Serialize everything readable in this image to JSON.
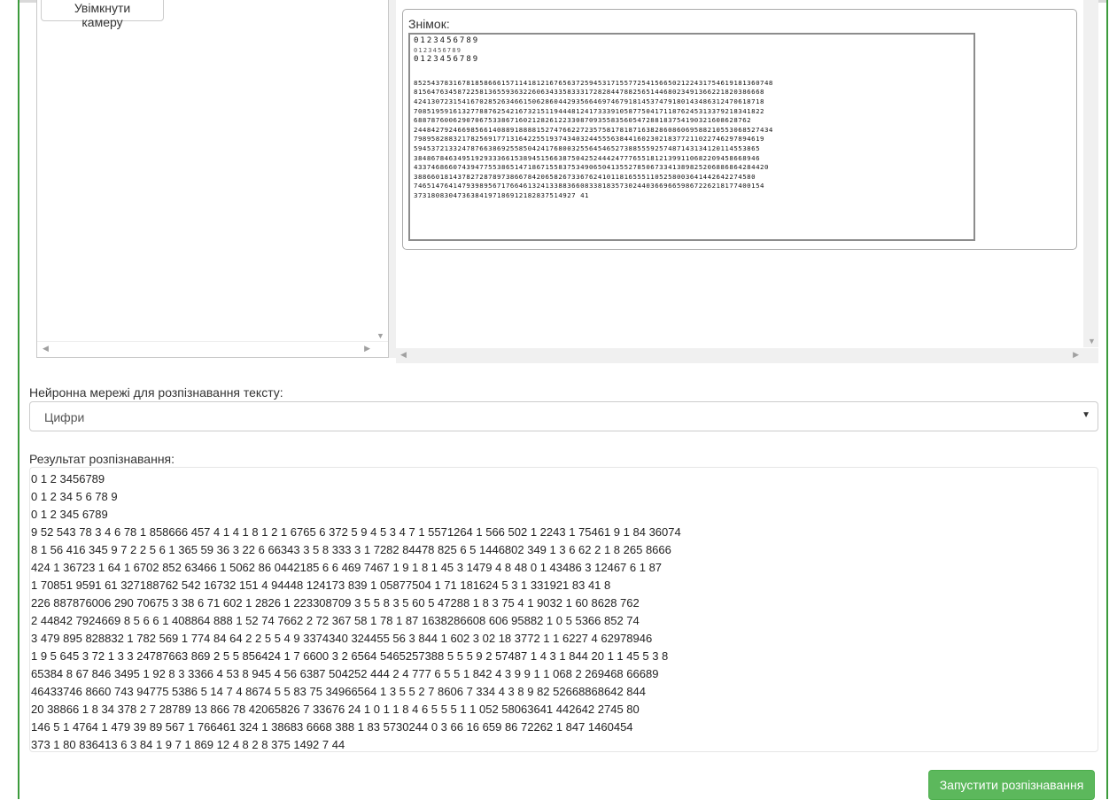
{
  "camera": {
    "enable_button": "Увімкнути камеру"
  },
  "snapshot": {
    "legend": "Знімок:",
    "header_lines": [
      "0123456789",
      "0123456789",
      "0123456789"
    ],
    "digit_lines": [
      "8525437831678185866615711418121676563725945317155772541566502122431754619181360748",
      "81564763458722581365593632260634335833317282844788256514468023491366221820386668",
      "42413072315416702852634661506286044293566469746791814537479180143486312470618718",
      "70851959161327788762542167321511944481241733391058775041711876245313379218341822",
      "68878760062907067533867160212826122330870935583560547288183754190321608628762",
      "2448427924669856614088918888152747662272357581781871638286086069588210553068527434",
      "79895828832178256917713164225519374340324455563844160230218377211022746297894619",
      "5945372133247876638692558504241768003255645465273885559257487143134120114553865",
      "3848678463495192933366153894515663875042524442477765518121399110682209458668946",
      "433746866074394775538651471867155837534906504135527850673341389825206886864284420",
      "388660181437827287897386678420658267336762410118165551105258003641442642274580",
      "74651476414793989567176646132413388366083381835730244036696659867226218177400154",
      "3731808304736384197186912182837514927 41"
    ]
  },
  "network": {
    "label": "Нейронна мережі для розпізнавання тексту:",
    "selected": "Цифри"
  },
  "result": {
    "label": "Результат розпізнавання:",
    "lines": [
      "0 1 2 3456789",
      "0 1 2 34 5 6 78 9",
      "0 1 2 345 6789",
      "9 52 543 78 3 4 6 78 1 858666 457 4 1 4 1 8 1 2 1 6765 6 372 5 9 4 5 3 4 7 1 5571264 1 566 502 1 2243 1 75461 9 1 84 36074",
      "8 1 56 416 345 9 7 2 2 5 6 1 365 59 36 3 22 6 66343 3 5 8 333 3 1 7282 84478 825 6 5 1446802 349 1 3 6 62 2 1 8 265 8666",
      "424 1 36723 1 64 1 6702 852 63466 1 5062 86 0442185 6 6 469 7467 1 9 1 8 1 45 3 1479 4 8 48 0 1 43486 3 12467 6 1 87",
      "1 70851 9591 61 327188762 542 16732 151 4 94448 124173 839 1 05877504 1 71 181624 5 3 1 331921 83 41 8",
      "226 887876006 290 70675 3 38 6 71 602 1 2826 1 223308709 3 5 5 8 3 5 60 5 47288 1 8 3 75 4 1 9032 1 60 8628 762",
      "2 44842 7924669 8 5 6 6 1 408864 888 1 52 74 7662 2 72 367 58 1 78 1 87 1638286608 606 95882 1 0 5 5366 852 74",
      "3 479 895 828832 1 782 569 1 774 84 64 2 2 5 5 4 9 3374340 324455 56 3 844 1 602 3 02 18 3772 1 1 6227 4 62978946",
      "1 9 5 645 3 72 1 3 3 24787663 869 2 5 5 856424 1 7 6600 3 2 6564 5465257388 5 5 5 9 2 57487 1 4 3 1 844 20 1 1 45 5 3 8",
      "65384 8 67 846 3495 1 92 8 3 3366 4 53 8 945 4 56 6387 504252 444 2 4 777 6 5 5 1 842 4 3 9 9 1 1 068 2 269468 66689",
      "46433746 8660 743 94775 5386 5 14 7 4 8674 5 5 83 75 34966564 1 3 5 5 2 7 8606 7 334 4 3 8 9 82 52668868642 844",
      "20 38866 1 8 34 378 2 7 28789 13 866 78 42065826 7 33676 24 1 0 1 1 8 4 6 5 5 5 1 1 052 58063641 442642 2745 80",
      "146 5 1 4764 1 479 39 89 567 1 766461 324 1 38683 6668 388 1 83 5730244 0 3 66 16 659 86 72262 1 847 1460454",
      "373 1 80 836413 6 3 84 1 9 7 1 869 12 4 8 2 8 375 1492 7 44"
    ]
  },
  "actions": {
    "run_label": "Запустити розпізнавання"
  }
}
